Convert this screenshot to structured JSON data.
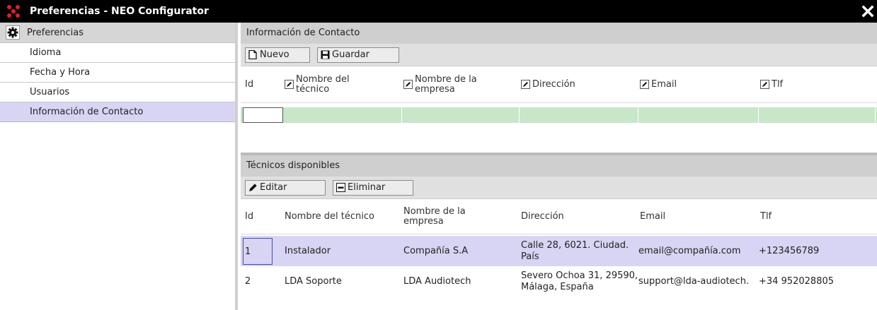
{
  "window": {
    "title": "Preferencias - NEO Configurator",
    "accent_color": "#e0202a"
  },
  "sidebar": {
    "header_label": "Preferencias",
    "items": [
      {
        "label": "Idioma"
      },
      {
        "label": "Fecha y Hora"
      },
      {
        "label": "Usuarios"
      },
      {
        "label": "Información de Contacto",
        "active": true
      }
    ],
    "active_color": "#d7d5f3"
  },
  "contact_section": {
    "title": "Información de Contacto",
    "toolbar": {
      "new_label": "Nuevo",
      "save_label": "Guardar"
    },
    "columns": {
      "id": "Id",
      "name": "Nombre del técnico",
      "company": "Nombre de la empresa",
      "address": "Dirección",
      "email": "Email",
      "phone": "Tlf"
    }
  },
  "technicians_section": {
    "title": "Técnicos disponibles",
    "toolbar": {
      "edit_label": "Editar",
      "delete_label": "Eliminar"
    },
    "columns": {
      "id": "Id",
      "name": "Nombre del técnico",
      "company": "Nombre de la empresa",
      "address": "Dirección",
      "email": "Email",
      "phone": "Tlf"
    },
    "rows": [
      {
        "id": "1",
        "name": "Instalador",
        "company": "Compañía S.A",
        "address": "Calle 28, 6021. Ciudad. País",
        "email": "email@compañía.com",
        "phone": "+123456789",
        "selected": true
      },
      {
        "id": "2",
        "name": "LDA Soporte",
        "company": "LDA Audiotech",
        "address": "Severo Ochoa 31, 29590, Málaga, España",
        "email": "support@lda-audiotech.",
        "phone": "+34 952028805",
        "selected": false
      }
    ]
  }
}
